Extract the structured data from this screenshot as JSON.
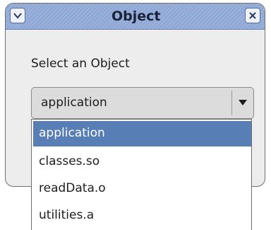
{
  "window": {
    "title": "Object"
  },
  "prompt": "Select an Object",
  "combo": {
    "value": "application"
  },
  "dropdown": {
    "options": [
      "application",
      "classes.so",
      "readData.o",
      "utilities.a"
    ],
    "selected_index": 0
  },
  "colors": {
    "titlebar": "#8fa8d6",
    "selection": "#587fb5",
    "window_bg": "#ededed"
  },
  "icons": {
    "menu": "chevron-down-icon",
    "close": "close-icon",
    "combo": "dropdown-arrow-icon"
  }
}
